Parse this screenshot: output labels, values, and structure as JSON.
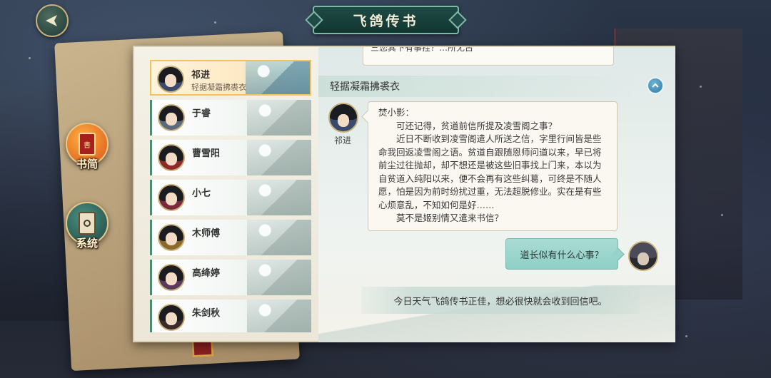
{
  "header": {
    "title": "飞鸽传书",
    "back_icon": "back-arrow-icon"
  },
  "side_tabs": [
    {
      "label": "书简",
      "icon": "scroll-icon",
      "active": true
    },
    {
      "label": "系统",
      "icon": "lantern-icon",
      "active": false
    }
  ],
  "contacts": [
    {
      "name": "祁进",
      "subtitle": "轻据凝霜拂裘衣",
      "active": true,
      "avatar_color": "#3a4a6a"
    },
    {
      "name": "于睿",
      "subtitle": "",
      "active": false,
      "avatar_color": "#5a6a7a"
    },
    {
      "name": "曹雪阳",
      "subtitle": "",
      "active": false,
      "avatar_color": "#8a2a2a"
    },
    {
      "name": "小七",
      "subtitle": "",
      "active": false,
      "avatar_color": "#7a2a3a"
    },
    {
      "name": "木师傅",
      "subtitle": "",
      "active": false,
      "avatar_color": "#8a6a2a"
    },
    {
      "name": "高绛婷",
      "subtitle": "",
      "active": false,
      "avatar_color": "#5a3a5a"
    },
    {
      "name": "朱剑秋",
      "subtitle": "",
      "active": false,
      "avatar_color": "#3a2a2a"
    }
  ],
  "chat": {
    "previous_message": "三您其下有事挂？…所无古",
    "header_title": "轻据凝霜拂裘衣",
    "sender_name": "祁进",
    "letter": {
      "salutation": "焚小影：",
      "paragraphs": [
        "可还记得，贫道前信所提及凌雪阁之事？",
        "近日不断收到凌雪阁遣人所送之信，字里行间皆是些命我回返凌雪阁之语。贫道自跟随恩师问道以来，早已将前尘过往抛却，却不想还是被这些旧事找上门来，本以为自贫道入纯阳以来，便不会再有这些纠葛，可终是不随人愿，怕是因为前时纷扰过重，无法超脱修业。实在是有些心烦意乱，不知如何是好……",
        "莫不是姬别情又遣来书信？"
      ]
    },
    "reply": "道长似有什么心事？",
    "notice": "今日天气飞鸽传书正佳，想必很快就会收到回信吧。"
  }
}
